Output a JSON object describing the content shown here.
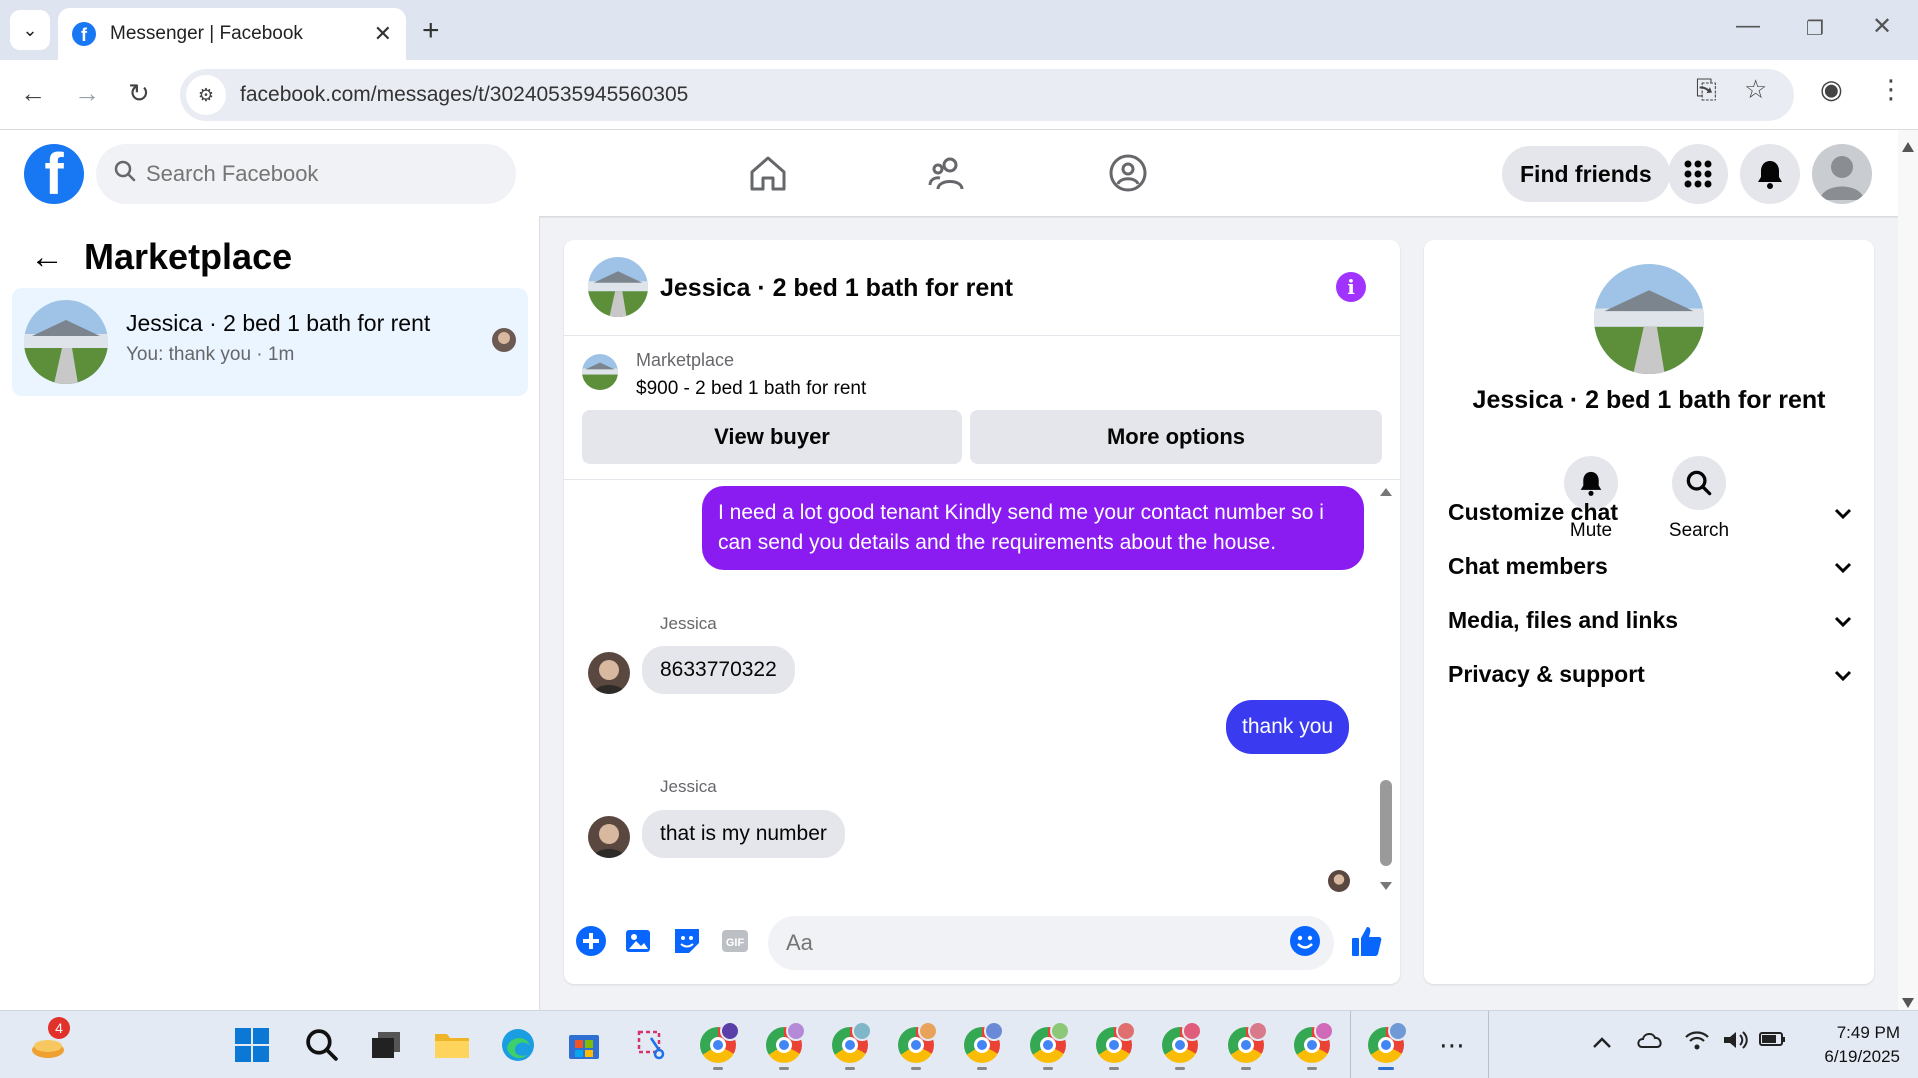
{
  "browser": {
    "tab_title": "Messenger | Facebook",
    "url": "facebook.com/messages/t/30240535945560305"
  },
  "fb": {
    "search_placeholder": "Search Facebook",
    "find_friends": "Find friends"
  },
  "left": {
    "title": "Marketplace",
    "conversation": {
      "name": "Jessica · 2 bed 1 bath for rent",
      "preview": "You: thank you · 1m"
    }
  },
  "chat": {
    "header_name": "Jessica · 2 bed 1 bath for rent",
    "listing_label": "Marketplace",
    "listing_price": "$900 - 2 bed 1 bath for rent",
    "view_buyer": "View buyer",
    "more_options": "More options",
    "messages": [
      {
        "from": "me",
        "text": "I need a lot good tenant Kindly send me your contact number so i can send you details and the requirements about the house."
      },
      {
        "from": "Jessica",
        "text": "8633770322"
      },
      {
        "from": "me",
        "text": "thank you"
      },
      {
        "from": "Jessica",
        "text": "that is my number"
      }
    ],
    "composer_placeholder": "Aa"
  },
  "right": {
    "name": "Jessica · 2 bed 1 bath for rent",
    "mute": "Mute",
    "search": "Search",
    "sections": [
      "Customize chat",
      "Chat members",
      "Media, files and links",
      "Privacy & support"
    ]
  },
  "taskbar": {
    "notification_count": "4",
    "time": "7:49 PM",
    "date": "6/19/2025"
  },
  "colors": {
    "fb_blue": "#1877f2",
    "bubble_purple": "#8a1cf2",
    "bubble_blue": "#3a3bf0",
    "info_purple": "#a033ff"
  }
}
